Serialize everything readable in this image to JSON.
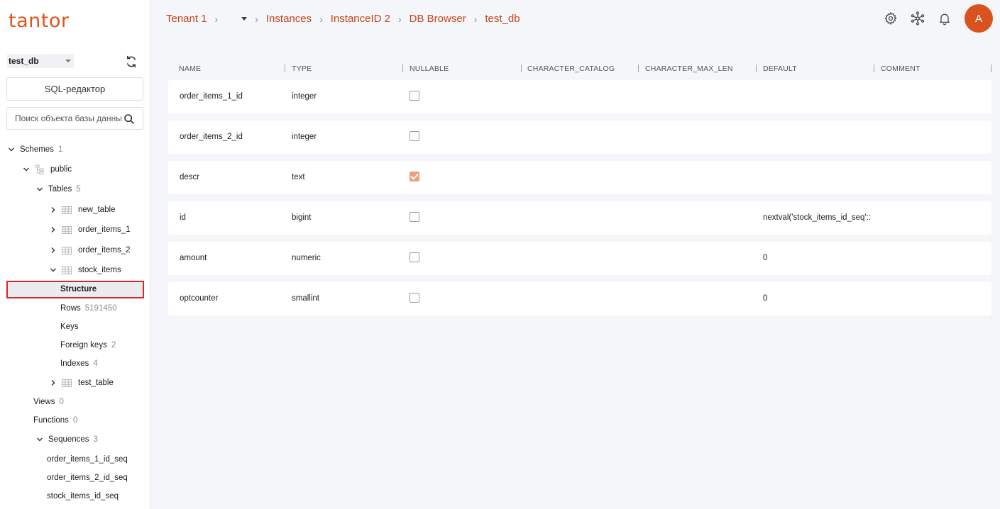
{
  "brand": {
    "logo_text": "tantor",
    "accent": "#e0541e"
  },
  "sidebar": {
    "db_selected": "test_db",
    "sql_button": "SQL-редактор",
    "search_placeholder": "Поиск объекта базы данных",
    "tree": {
      "schemes": {
        "label": "Schemes",
        "count": "1"
      },
      "public": {
        "label": "public"
      },
      "tables": {
        "label": "Tables",
        "count": "5"
      },
      "new_table": {
        "label": "new_table"
      },
      "order_items_1": {
        "label": "order_items_1"
      },
      "order_items_2": {
        "label": "order_items_2"
      },
      "stock_items": {
        "label": "stock_items"
      },
      "structure": {
        "label": "Structure"
      },
      "rows": {
        "label": "Rows",
        "count": "5191450"
      },
      "keys": {
        "label": "Keys"
      },
      "foreign_keys": {
        "label": "Foreign keys",
        "count": "2"
      },
      "indexes": {
        "label": "Indexes",
        "count": "4"
      },
      "test_table": {
        "label": "test_table"
      },
      "views": {
        "label": "Views",
        "count": "0"
      },
      "functions": {
        "label": "Functions",
        "count": "0"
      },
      "sequences": {
        "label": "Sequences",
        "count": "3"
      },
      "seq1": {
        "label": "order_items_1_id_seq"
      },
      "seq2": {
        "label": "order_items_2_id_seq"
      },
      "seq3": {
        "label": "stock_items_id_seq"
      }
    }
  },
  "breadcrumb": {
    "tenant": "Tenant 1",
    "instances": "Instances",
    "instance": "InstanceID 2",
    "browser": "DB Browser",
    "db": "test_db"
  },
  "header": {
    "avatar_letter": "A"
  },
  "table": {
    "columns": [
      "NAME",
      "TYPE",
      "NULLABLE",
      "CHARACTER_CATALOG",
      "CHARACTER_MAX_LEN",
      "DEFAULT",
      "COMMENT"
    ],
    "rows": [
      {
        "name": "order_items_1_id",
        "type": "integer",
        "nullable": false,
        "catalog": "",
        "max_len": "",
        "default": "",
        "comment": ""
      },
      {
        "name": "order_items_2_id",
        "type": "integer",
        "nullable": false,
        "catalog": "",
        "max_len": "",
        "default": "",
        "comment": ""
      },
      {
        "name": "descr",
        "type": "text",
        "nullable": true,
        "catalog": "",
        "max_len": "",
        "default": "",
        "comment": ""
      },
      {
        "name": "id",
        "type": "bigint",
        "nullable": false,
        "catalog": "",
        "max_len": "",
        "default": "nextval('stock_items_id_seq'::",
        "comment": ""
      },
      {
        "name": "amount",
        "type": "numeric",
        "nullable": false,
        "catalog": "",
        "max_len": "",
        "default": "0",
        "comment": ""
      },
      {
        "name": "optcounter",
        "type": "smallint",
        "nullable": false,
        "catalog": "",
        "max_len": "",
        "default": "0",
        "comment": ""
      }
    ]
  }
}
